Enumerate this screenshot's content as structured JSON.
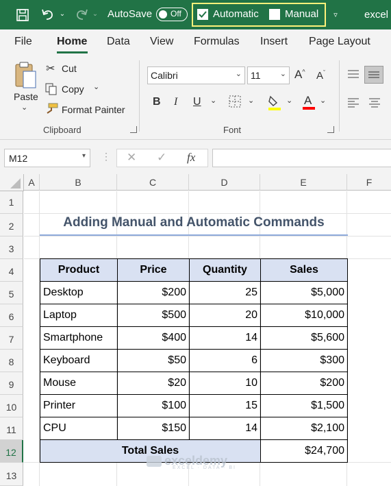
{
  "titlebar": {
    "autosave_label": "AutoSave",
    "autosave_state": "Off",
    "calc_automatic": "Automatic",
    "calc_manual": "Manual",
    "filename": "excel"
  },
  "tabs": [
    "File",
    "Home",
    "Data",
    "View",
    "Formulas",
    "Insert",
    "Page Layout"
  ],
  "ribbon": {
    "paste": "Paste",
    "cut": "Cut",
    "copy": "Copy",
    "format_painter": "Format Painter",
    "clipboard_group": "Clipboard",
    "font_name": "Calibri",
    "font_size": "11",
    "font_group": "Font",
    "bold": "B",
    "italic": "I",
    "underline": "U",
    "font_color": "A",
    "highlight_color": "#ffff00",
    "fontcolor_color": "#ff0000"
  },
  "formula_bar": {
    "name_box": "M12",
    "fx": "fx",
    "content": ""
  },
  "sheet": {
    "columns": [
      "A",
      "B",
      "C",
      "D",
      "E",
      "F"
    ],
    "rows": [
      "1",
      "2",
      "3",
      "4",
      "5",
      "6",
      "7",
      "8",
      "9",
      "10",
      "11",
      "12",
      "13"
    ],
    "selected_row": "12",
    "title": "Adding Manual and Automatic Commands",
    "headers": [
      "Product",
      "Price",
      "Quantity",
      "Sales"
    ],
    "data": [
      [
        "Desktop",
        "$200",
        "25",
        "$5,000"
      ],
      [
        "Laptop",
        "$500",
        "20",
        "$10,000"
      ],
      [
        "Smartphone",
        "$400",
        "14",
        "$5,600"
      ],
      [
        "Keyboard",
        "$50",
        "6",
        "$300"
      ],
      [
        "Mouse",
        "$20",
        "10",
        "$200"
      ],
      [
        "Printer",
        "$100",
        "15",
        "$1,500"
      ],
      [
        "CPU",
        "$150",
        "14",
        "$2,100"
      ]
    ],
    "total_label": "Total Sales",
    "total_value": "$24,700",
    "header_fill": "#d9e1f2"
  },
  "watermark": {
    "brand": "exceldemy",
    "tagline": "EXCEL · DATA · BI"
  }
}
